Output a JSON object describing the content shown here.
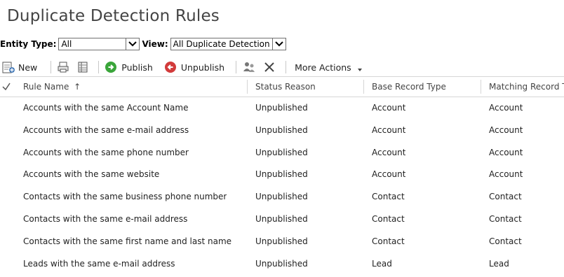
{
  "title": "Duplicate Detection Rules",
  "filters": {
    "entity_type_label": "Entity Type:",
    "entity_type_value": "All",
    "view_label": "View:",
    "view_value": "All Duplicate Detection Ru"
  },
  "toolbar": {
    "new_label": "New",
    "publish_label": "Publish",
    "unpublish_label": "Unpublish",
    "more_actions_label": "More Actions"
  },
  "grid": {
    "columns": [
      "Rule Name",
      "Status Reason",
      "Base Record Type",
      "Matching Record Ty"
    ],
    "sort_indicator": "↑",
    "rows": [
      {
        "name": "Accounts with the same Account Name",
        "status": "Unpublished",
        "base": "Account",
        "matching": "Account"
      },
      {
        "name": "Accounts with the same e-mail address",
        "status": "Unpublished",
        "base": "Account",
        "matching": "Account"
      },
      {
        "name": "Accounts with the same phone number",
        "status": "Unpublished",
        "base": "Account",
        "matching": "Account"
      },
      {
        "name": "Accounts with the same website",
        "status": "Unpublished",
        "base": "Account",
        "matching": "Account"
      },
      {
        "name": "Contacts with the same business phone number",
        "status": "Unpublished",
        "base": "Contact",
        "matching": "Contact"
      },
      {
        "name": "Contacts with the same e-mail address",
        "status": "Unpublished",
        "base": "Contact",
        "matching": "Contact"
      },
      {
        "name": "Contacts with the same first name and last name",
        "status": "Unpublished",
        "base": "Contact",
        "matching": "Contact"
      },
      {
        "name": "Leads with the same e-mail address",
        "status": "Unpublished",
        "base": "Lead",
        "matching": "Lead"
      }
    ]
  },
  "icons": {
    "new": "new-record-icon",
    "print": "print-icon",
    "export": "export-icon",
    "publish": "publish-icon",
    "unpublish": "unpublish-icon",
    "assign": "assign-icon",
    "delete": "delete-icon",
    "more_actions": "dropdown-arrow-icon",
    "select_all": "checkmark-icon"
  },
  "colors": {
    "publish_green": "#3aa53a",
    "unpublish_red": "#d23b3b",
    "title_gray": "#444444"
  }
}
